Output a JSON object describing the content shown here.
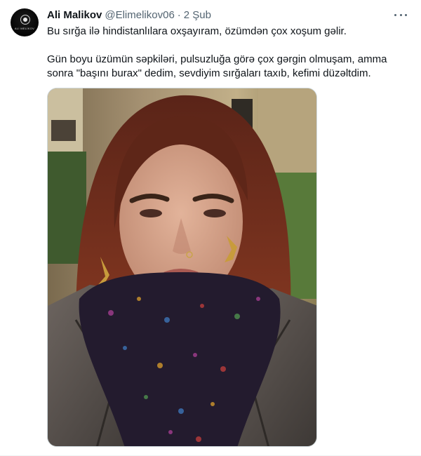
{
  "tweet": {
    "display_name": "Ali Malikov",
    "handle": "@Elimelikov06",
    "separator": "·",
    "date": "2 Şub",
    "avatar_caption": "ALİ MELİKOV",
    "paragraphs": [
      "Bu sırğa ilə hindistanlılara oxşayıram, özümdən çox xoşum gəlir.",
      "Gün boyu üzümün səpkiləri, pulsuzluğa görə çox gərgin olmuşam, amma sonra \"başını burax\" dedim, sevdiyim sırğaları taxıb, kefimi düzəltdim."
    ]
  },
  "icons": {
    "more": "more-horizontal-icon"
  },
  "colors": {
    "text_primary": "#0f1419",
    "text_secondary": "#536471",
    "border": "#cfd9de"
  }
}
